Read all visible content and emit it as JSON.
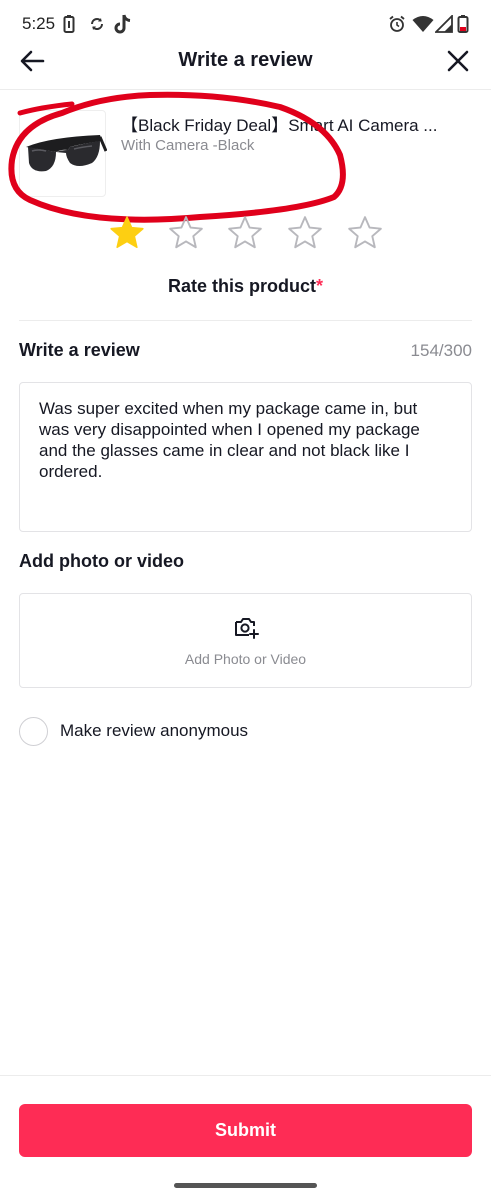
{
  "status_bar": {
    "time": "5:25",
    "left_icons": [
      "battery-saver-icon",
      "sync-icon",
      "tiktok-icon"
    ],
    "right_icons": [
      "alarm-icon",
      "wifi-icon",
      "signal-icon",
      "battery-icon"
    ]
  },
  "header": {
    "title": "Write a review",
    "back_icon": "arrow-left-icon",
    "close_icon": "close-icon"
  },
  "product": {
    "title": "【Black Friday Deal】Smart AI Camera ...",
    "variant": "With Camera -Black",
    "thumbnail": "sunglasses-product-image"
  },
  "rating": {
    "value": 1,
    "max": 5,
    "label": "Rate this product",
    "required_mark": "*",
    "filled_color": "#fdcf12",
    "empty_color": "#b8b8bd"
  },
  "review": {
    "heading": "Write a review",
    "char_count": "154/300",
    "text": "Was super excited when my package came in, but was very disappointed when I opened my package and the glasses came in clear and not black like I ordered."
  },
  "media": {
    "heading": "Add photo or video",
    "button_label": "Add Photo or Video",
    "icon": "camera-add-icon"
  },
  "anonymous": {
    "label": "Make review anonymous",
    "checked": false
  },
  "submit": {
    "label": "Submit",
    "color": "#fe2c55"
  },
  "annotation": {
    "color": "#e0001b"
  }
}
